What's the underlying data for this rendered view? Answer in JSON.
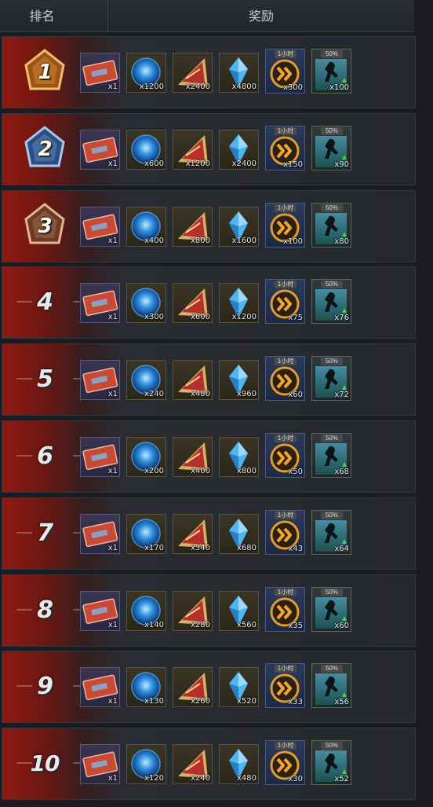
{
  "header": {
    "rank_label": "排名",
    "reward_label": "奖励"
  },
  "item_icons": [
    "ticket-card-icon",
    "blue-orb-icon",
    "red-triangle-badge-icon",
    "blue-crystal-icon",
    "speed-boost-icon",
    "teleport-runner-icon"
  ],
  "boost_tag": "1小时",
  "tele_tag": "50%",
  "rows": [
    {
      "rank": "1",
      "qty": [
        "x1",
        "x1200",
        "x2400",
        "x4800",
        "x300",
        "x100"
      ]
    },
    {
      "rank": "2",
      "qty": [
        "x1",
        "x600",
        "x1200",
        "x2400",
        "x150",
        "x90"
      ]
    },
    {
      "rank": "3",
      "qty": [
        "x1",
        "x400",
        "x800",
        "x1600",
        "x100",
        "x80"
      ]
    },
    {
      "rank": "4",
      "qty": [
        "x1",
        "x300",
        "x600",
        "x1200",
        "x75",
        "x76"
      ]
    },
    {
      "rank": "5",
      "qty": [
        "x1",
        "x240",
        "x480",
        "x960",
        "x60",
        "x72"
      ]
    },
    {
      "rank": "6",
      "qty": [
        "x1",
        "x200",
        "x400",
        "x800",
        "x50",
        "x68"
      ]
    },
    {
      "rank": "7",
      "qty": [
        "x1",
        "x170",
        "x340",
        "x680",
        "x43",
        "x64"
      ]
    },
    {
      "rank": "8",
      "qty": [
        "x1",
        "x140",
        "x280",
        "x560",
        "x35",
        "x60"
      ]
    },
    {
      "rank": "9",
      "qty": [
        "x1",
        "x130",
        "x260",
        "x520",
        "x33",
        "x56"
      ]
    },
    {
      "rank": "10",
      "qty": [
        "x1",
        "x120",
        "x240",
        "x480",
        "x30",
        "x52"
      ]
    }
  ],
  "colors": {
    "gold": "#c9892f",
    "silver": "#5f86b8",
    "bronze": "#9b6a4c",
    "rank_red": "#8e1a12"
  }
}
